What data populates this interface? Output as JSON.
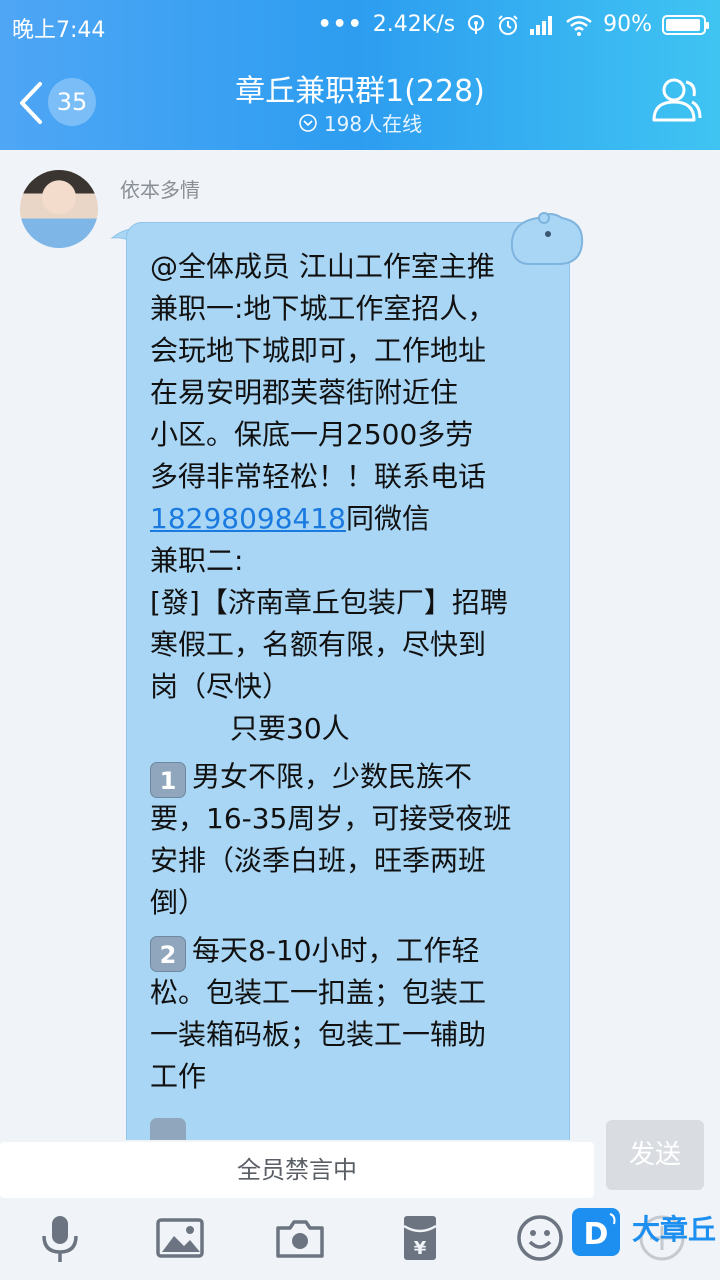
{
  "status_bar": {
    "time": "晚上7:44",
    "dots": "•••",
    "network_speed": "2.42K/s",
    "battery": "90%"
  },
  "header": {
    "unread_count": "35",
    "title": "章丘兼职群1(228)",
    "online": "198人在线"
  },
  "message": {
    "sender": "依本多情",
    "lines": [
      "@全体成员 江山工作室主推",
      "兼职一:地下城工作室招人，",
      "会玩地下城即可，工作地址",
      "在易安明郡芙蓉街附近住",
      "小区。保底一月2500多劳",
      "多得非常轻松！！联系电话"
    ],
    "phone": "18298098418",
    "phone_suffix": "同微信",
    "lines2": [
      "兼职二:",
      "[發]【济南章丘包装厂】招聘",
      "寒假工，名额有限，尽快到",
      "岗（尽快）"
    ],
    "need": "只要30人",
    "item1_key": "1",
    "item1": [
      "男女不限，少数民族不",
      "要，16-35周岁，可接受夜班",
      "安排（淡季白班，旺季两班",
      "倒）"
    ],
    "item2_key": "2",
    "item2": [
      "每天8-10小时，工作轻",
      "松。包装工一扣盖；包装工",
      "一装箱码板；包装工一辅助",
      "工作"
    ]
  },
  "input_bar": {
    "placeholder": "全员禁言中",
    "send_label": "发送"
  },
  "toolbar": {
    "icons": [
      "microphone-icon",
      "image-icon",
      "camera-icon",
      "red-packet-icon",
      "emoji-icon",
      "plus-icon"
    ]
  },
  "watermark": {
    "text": "大章丘"
  },
  "colors": {
    "header_start": "#4fa6f5",
    "header_end": "#3fc4f2",
    "bubble": "#a9d6f5",
    "link": "#1a7ae0"
  }
}
